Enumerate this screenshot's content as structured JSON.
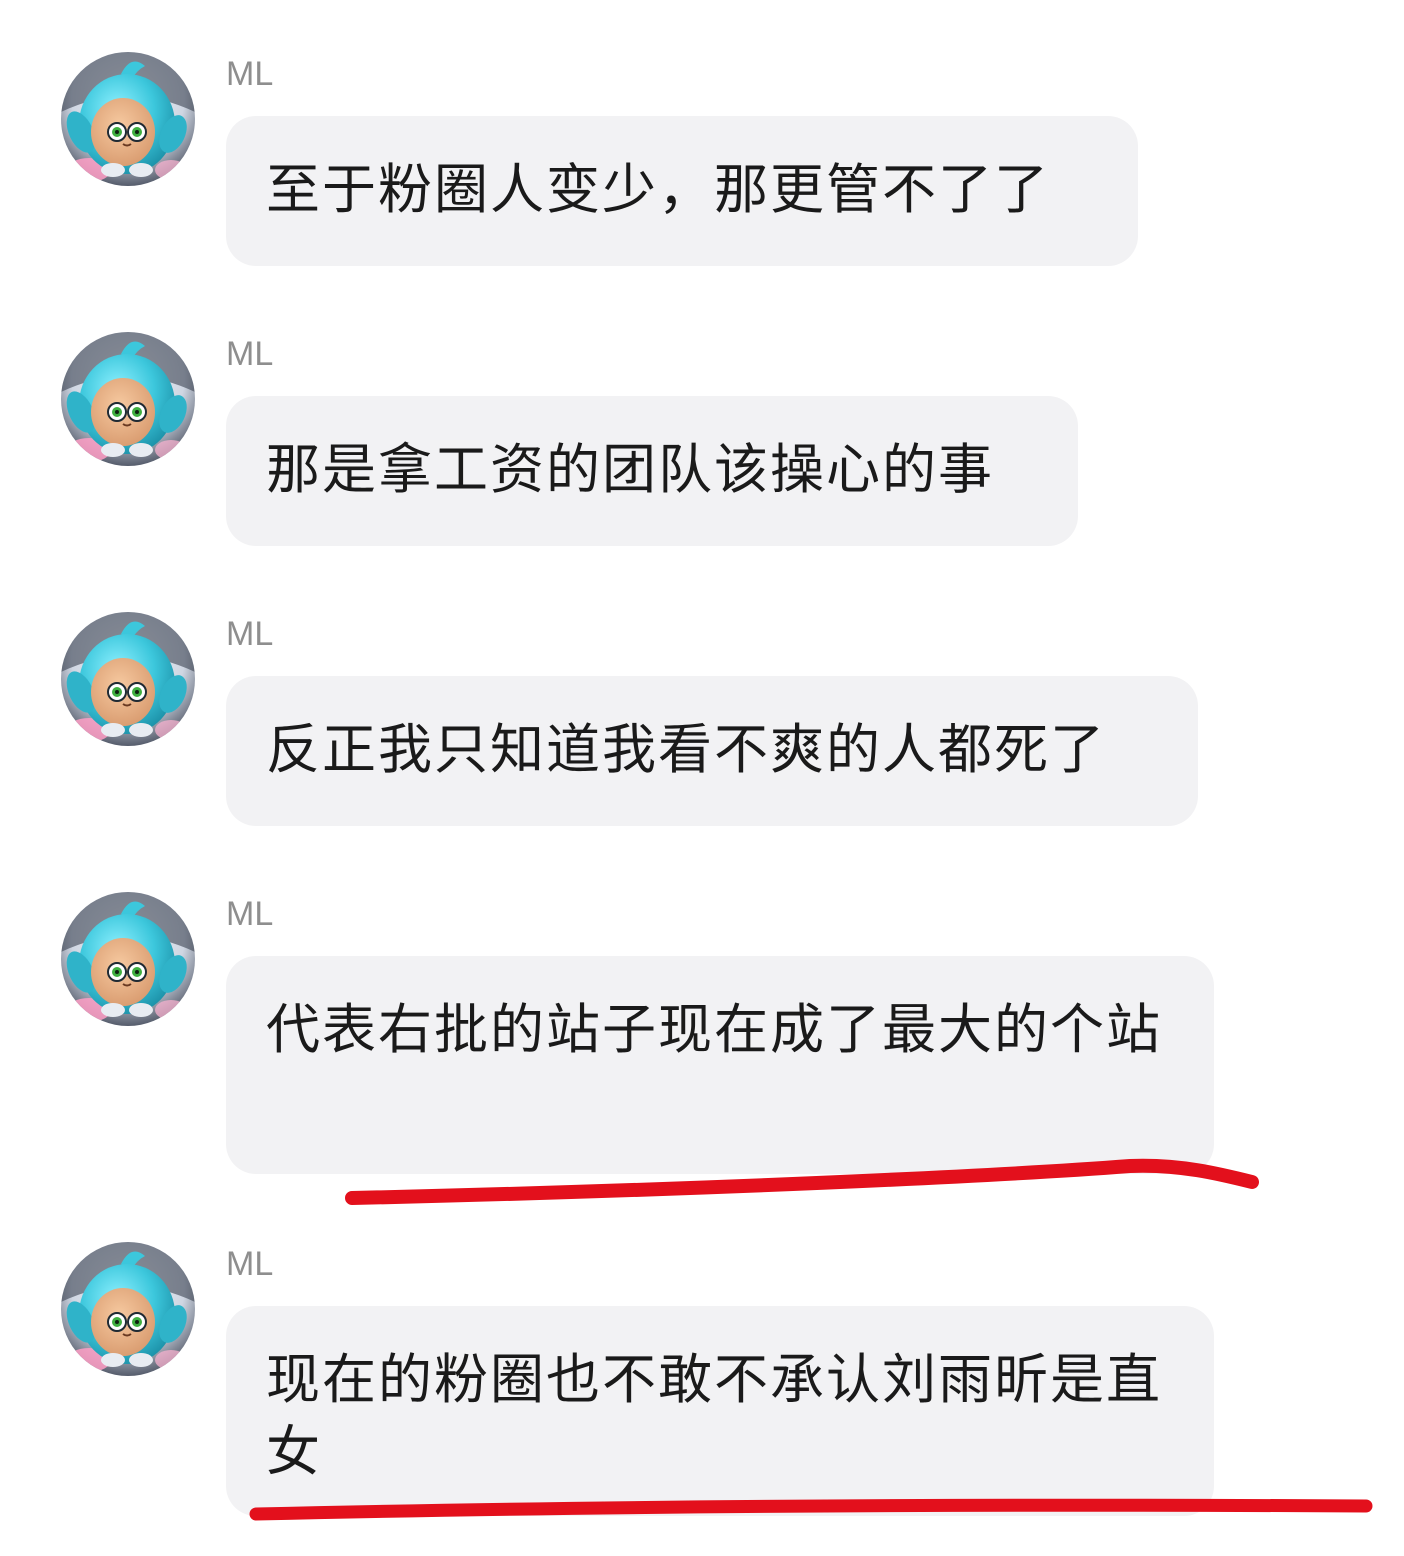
{
  "messages": [
    {
      "sender": "ML",
      "text": "至于粉圈人变少，那更管不了了"
    },
    {
      "sender": "ML",
      "text": "那是拿工资的团队该操心的事"
    },
    {
      "sender": "ML",
      "text": "反正我只知道我看不爽的人都死了"
    },
    {
      "sender": "ML",
      "text": "代表右批的站子现在成了最大的个站",
      "underlined": true
    },
    {
      "sender": "ML",
      "text": "现在的粉圈也不敢不承认刘雨昕是直女",
      "underlined": true
    }
  ],
  "colors": {
    "bubble": "#f2f2f4",
    "sender_name": "#8e8e8e",
    "message_text": "#1a1a1a",
    "annotation_underline": "#e3101c",
    "avatar_character": "#3cc7dc"
  },
  "icons": {
    "avatar": "cyan-cartoon-character-avatar"
  }
}
